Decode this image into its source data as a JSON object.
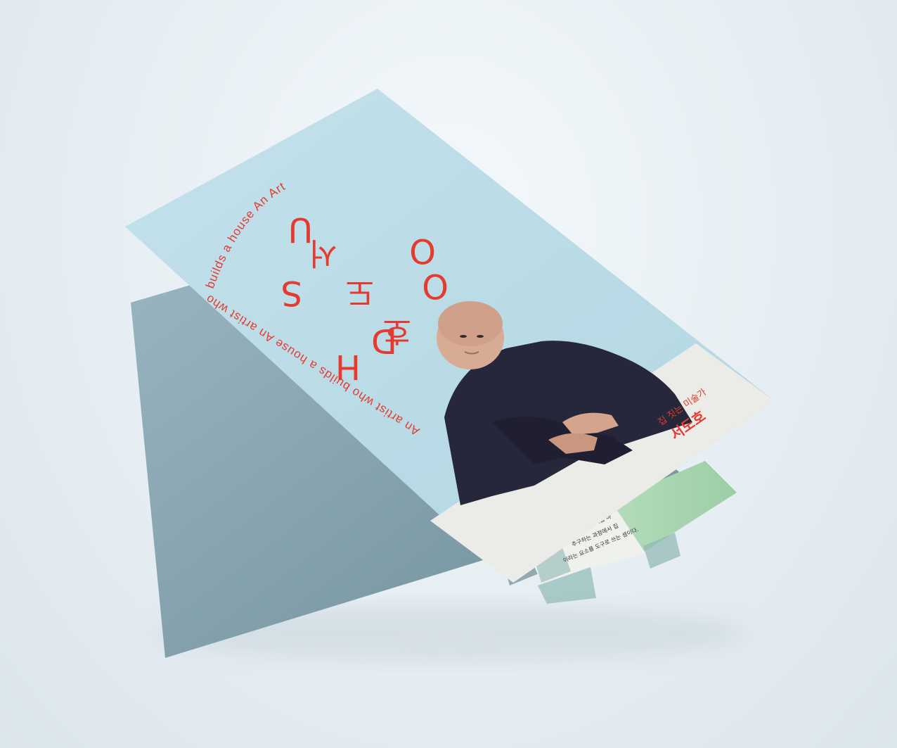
{
  "brochure": {
    "curved_text_top": "An artist who builds a house  An artist who builds a house  An Art",
    "curved_text_bottom": "An artist who builds a house  An",
    "latin_letters": [
      "D",
      "O",
      "H",
      "O",
      "S",
      "U"
    ],
    "korean_letters": [
      "서",
      "도",
      "호"
    ],
    "subtitle": "집 짓는 미술가",
    "name": "서도호",
    "inner_text_lines": [
      "세계를 바",
      "추구하는 과정에서 집",
      "이라는 요소를 도구로 쓰는 셈이다."
    ]
  },
  "colors": {
    "cover_blue": "#b8dbe6",
    "cover_red": "#e53a2f",
    "back_panel": "#90aeb9",
    "inner_green": "#a9d7b1",
    "inner_white": "#f2f2ee",
    "jacket": "#26253a"
  }
}
